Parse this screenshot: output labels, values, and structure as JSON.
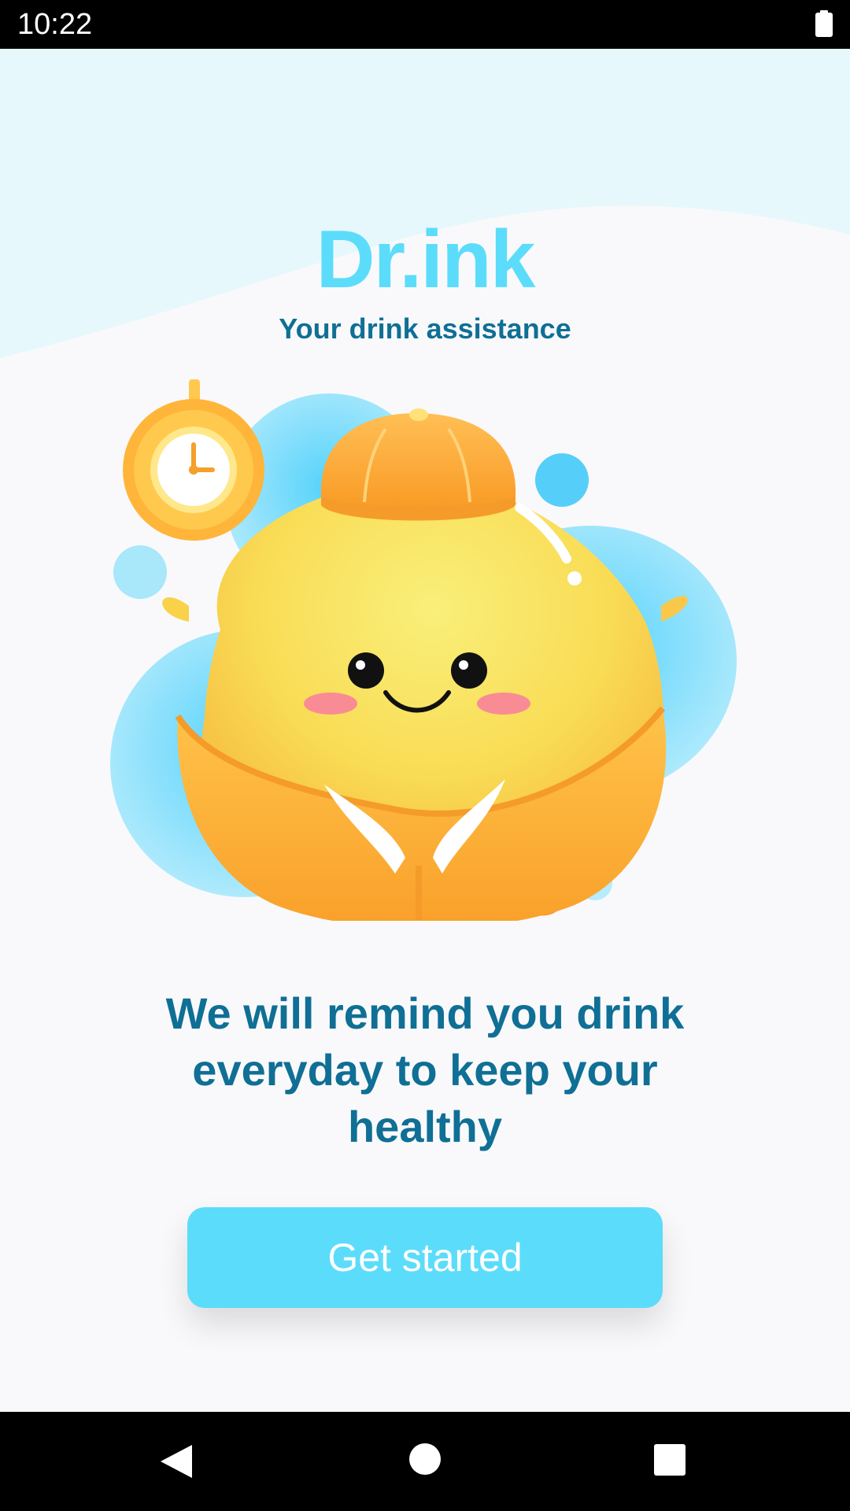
{
  "status_bar": {
    "time": "10:22",
    "battery_icon": "battery-icon"
  },
  "header": {
    "title": "Dr.ink",
    "subtitle": "Your drink assistance"
  },
  "illustration": {
    "icon": "smiling-yellow-mascot-with-clock-illustration"
  },
  "onboarding": {
    "tagline": "We will remind you drink everyday to keep your healthy",
    "get_started_label": "Get started"
  },
  "nav_bar": {
    "back_icon": "back-triangle-icon",
    "home_icon": "home-circle-icon",
    "recents_icon": "recents-square-icon"
  },
  "colors": {
    "accent": "#5cdcfb",
    "text_dark": "#0f6f95",
    "header_wave": "#e6f8fc",
    "background": "#f9f9fb"
  }
}
